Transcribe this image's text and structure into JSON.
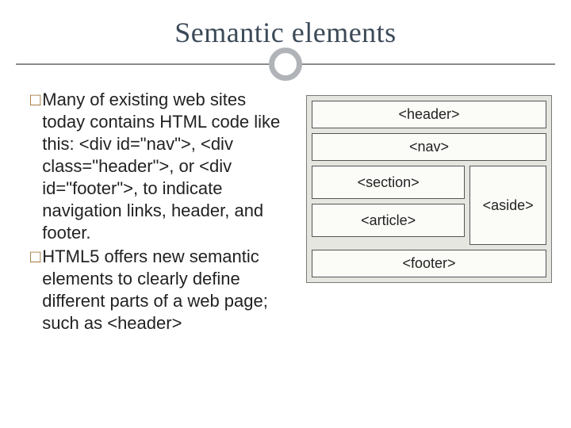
{
  "title": "Semantic elements",
  "bullets": [
    "Many of existing web sites today contains HTML code like this: <div id=\"nav\">, <div class=\"header\">, or <div id=\"footer\">, to indicate navigation links, header, and footer.",
    "HTML5 offers new semantic elements to clearly define different parts of a web page; such as <header>"
  ],
  "diagram": {
    "header": "<header>",
    "nav": "<nav>",
    "section": "<section>",
    "article": "<article>",
    "aside": "<aside>",
    "footer": "<footer>"
  }
}
